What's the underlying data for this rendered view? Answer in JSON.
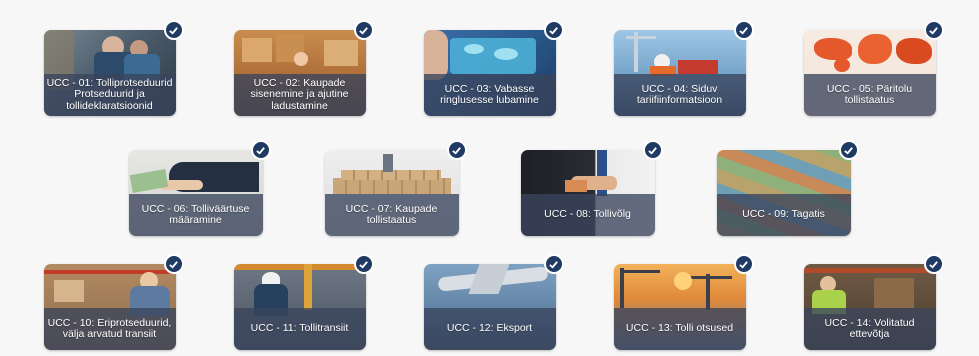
{
  "tiles": [
    {
      "label": "UCC - 01: Tolliprotseduurid Protseduurid ja tollideklaratsioonid",
      "theme": "office-two-people",
      "checked": true
    },
    {
      "label": "UCC - 02: Kaupade sisenemine ja ajutine ladustamine",
      "theme": "warehouse-boxes",
      "checked": true
    },
    {
      "label": "UCC - 03: Vabasse ringlusesse lubamine",
      "theme": "world-map-phone",
      "checked": true
    },
    {
      "label": "UCC - 04: Siduv tariifiinformatsioon",
      "theme": "port-worker",
      "checked": true
    },
    {
      "label": "UCC - 05: Päritolu tollistaatus",
      "theme": "orange-world-map",
      "checked": true
    },
    {
      "label": "UCC - 06: Tolliväärtuse määramine",
      "theme": "money-hands",
      "checked": true
    },
    {
      "label": "UCC - 07: Kaupade tollistaatus",
      "theme": "boxes-figure",
      "checked": true
    },
    {
      "label": "UCC - 08: Tollivõlg",
      "theme": "suit-cash",
      "checked": true
    },
    {
      "label": "UCC - 09: Tagatis",
      "theme": "banknotes",
      "checked": true
    },
    {
      "label": "UCC - 10: Eriprotseduurid, välja arvatud transiit",
      "theme": "warehouse-woman",
      "checked": true
    },
    {
      "label": "UCC - 11: Tollitransiit",
      "theme": "warehouse-worker",
      "checked": true
    },
    {
      "label": "UCC - 12: Eksport",
      "theme": "airplane-cargo",
      "checked": true
    },
    {
      "label": "UCC - 13: Tolli otsused",
      "theme": "port-cranes-sunset",
      "checked": true
    },
    {
      "label": "UCC - 14: Volitatud ettevõtja",
      "theme": "warehouse-tablet",
      "checked": true
    }
  ],
  "colors": {
    "band": "#3a445c",
    "badge": "#1f3a63"
  }
}
